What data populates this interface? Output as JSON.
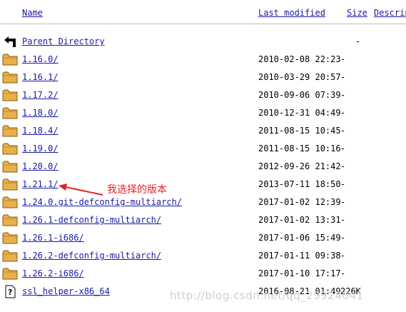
{
  "headers": {
    "name": "Name",
    "last_modified": "Last modified",
    "size": "Size",
    "description": "Descrip"
  },
  "parent": {
    "name": "Parent Directory",
    "size": "-"
  },
  "rows": [
    {
      "name": "1.16.0/",
      "date": "2010-02-08 22:23",
      "size": "-",
      "icon": "folder-icon"
    },
    {
      "name": "1.16.1/",
      "date": "2010-03-29 20:57",
      "size": "-",
      "icon": "folder-icon"
    },
    {
      "name": "1.17.2/",
      "date": "2010-09-06 07:39",
      "size": "-",
      "icon": "folder-icon"
    },
    {
      "name": "1.18.0/",
      "date": "2010-12-31 04:49",
      "size": "-",
      "icon": "folder-icon"
    },
    {
      "name": "1.18.4/",
      "date": "2011-08-15 10:45",
      "size": "-",
      "icon": "folder-icon"
    },
    {
      "name": "1.19.0/",
      "date": "2011-08-15 10:16",
      "size": "-",
      "icon": "folder-icon"
    },
    {
      "name": "1.20.0/",
      "date": "2012-09-26 21:42",
      "size": "-",
      "icon": "folder-icon"
    },
    {
      "name": "1.21.1/",
      "date": "2013-07-11 18:50",
      "size": "-",
      "icon": "folder-icon"
    },
    {
      "name": "1.24.0.git-defconfig-multiarch/",
      "date": "2017-01-02 12:39",
      "size": "-",
      "icon": "folder-icon"
    },
    {
      "name": "1.26.1-defconfig-multiarch/",
      "date": "2017-01-02 13:31",
      "size": "-",
      "icon": "folder-icon"
    },
    {
      "name": "1.26.1-i686/",
      "date": "2017-01-06 15:49",
      "size": "-",
      "icon": "folder-icon"
    },
    {
      "name": "1.26.2-defconfig-multiarch/",
      "date": "2017-01-11 09:38",
      "size": "-",
      "icon": "folder-icon"
    },
    {
      "name": "1.26.2-i686/",
      "date": "2017-01-10 17:17",
      "size": "-",
      "icon": "folder-icon"
    },
    {
      "name": "ssl_helper-x86_64",
      "date": "2016-08-21 01:49",
      "size": "226K",
      "icon": "unknown-file-icon"
    }
  ],
  "annotation": {
    "text": "我选择的版本",
    "color": "#e0222a"
  },
  "watermark": "http://blog.csdn.net/qq_29924041",
  "colors": {
    "link": "#1a1aa6",
    "folder": "#e8b04a",
    "annotation": "#e0222a"
  }
}
